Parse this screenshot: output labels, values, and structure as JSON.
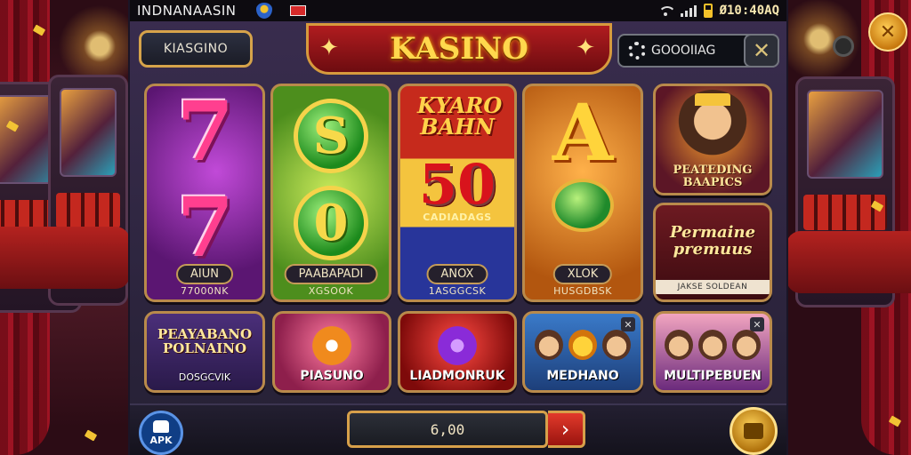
{
  "status_bar": {
    "title": "INDNANAASIN",
    "clock": "Ø10:40AQ"
  },
  "header": {
    "left_button": "KIASGINO",
    "banner_title": "KASINO",
    "search_value": "GOOOIIAG"
  },
  "games": [
    {
      "pill": "AIUN",
      "sub": "77000NK",
      "symbol": "77"
    },
    {
      "pill": "PAABAPADI",
      "sub": "XGSOOK",
      "symbol": "S"
    },
    {
      "pill": "ANOX",
      "sub": "1ASGGCSK",
      "headline": "KYARO BAHN",
      "symbol": "50",
      "tagline": "CADIADAGS"
    },
    {
      "pill": "XLOK",
      "sub": "HUSGDBSK",
      "symbol": "A"
    }
  ],
  "side_cards": [
    {
      "title": "PEATEDING BAAPICS"
    },
    {
      "title": "Permaine premuus",
      "sub": "JAKSE SOLDEAN"
    }
  ],
  "bottom_games": [
    {
      "title": "PEAYABANO POLNAINO",
      "label": "DOSGCVIK"
    },
    {
      "label": "PIASUNO"
    },
    {
      "label": "LIADMONRUK"
    },
    {
      "label": "MEDHANO"
    },
    {
      "label": "MULTIPEBUEN"
    }
  ],
  "bottom_bar": {
    "apk_label": "APK",
    "amount": "6,00",
    "go_symbol": "›"
  },
  "colors": {
    "gold": "#d7a04a",
    "banner_red": "#b01c1f",
    "title_yellow": "#ffd84d"
  },
  "icons": {
    "close": "close-icon",
    "settings": "gear-icon",
    "wifi": "wifi-icon",
    "signal": "signal-icon",
    "battery": "battery-icon",
    "android": "android-icon",
    "tools": "tools-icon"
  }
}
